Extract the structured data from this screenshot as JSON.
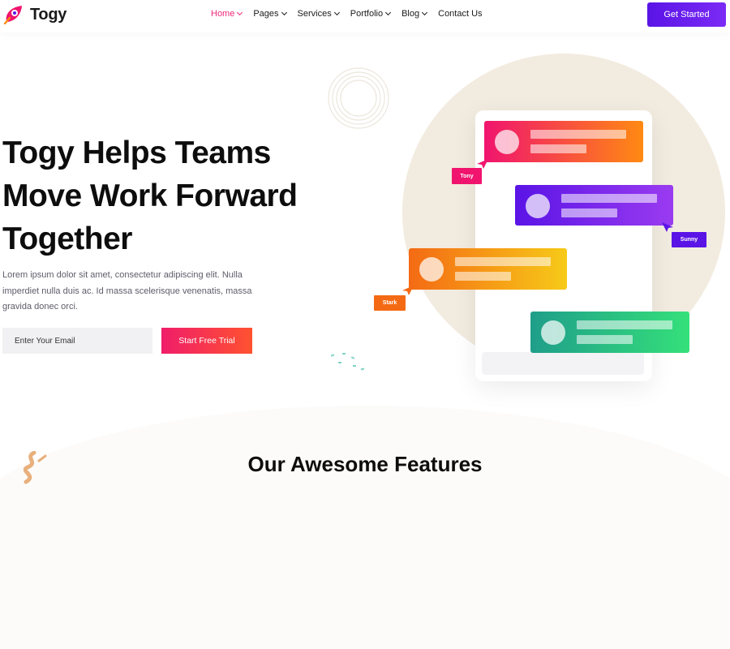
{
  "header": {
    "logo_text": "Togy",
    "logo_icon": "rocket-icon",
    "nav": [
      {
        "label": "Home",
        "active": true,
        "dropdown": true
      },
      {
        "label": "Pages",
        "active": false,
        "dropdown": true
      },
      {
        "label": "Services",
        "active": false,
        "dropdown": true
      },
      {
        "label": "Portfolio",
        "active": false,
        "dropdown": true
      },
      {
        "label": "Blog",
        "active": false,
        "dropdown": true
      },
      {
        "label": "Contact Us",
        "active": false,
        "dropdown": false
      }
    ],
    "cta_label": "Get Started"
  },
  "hero": {
    "title_lines": [
      "Togy Helps Teams",
      "Move Work Forward",
      "Together"
    ],
    "description": "Lorem ipsum dolor sit amet, consectetur adipiscing elit. Nulla imperdiet nulla duis ac. Id massa scelerisque venenatis, massa gravida donec orci.",
    "email_placeholder": "Enter Your Email",
    "trial_button": "Start Free Trial"
  },
  "chat": {
    "tags": [
      "Tony",
      "Sunny",
      "Stark"
    ]
  },
  "features": {
    "title": "Our Awesome Features"
  },
  "colors": {
    "accent_pink": "#f0287a",
    "accent_purple": "#5a14e6",
    "orange": "#f46a14",
    "green": "#35e07a"
  }
}
